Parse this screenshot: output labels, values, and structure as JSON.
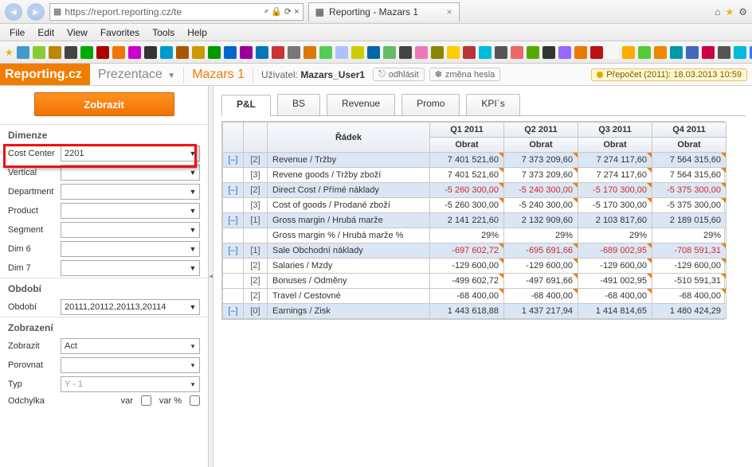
{
  "browser": {
    "url": "https://report.reporting.cz/te",
    "url_right": "𝄎 🔒 ⟳ ×",
    "search": "",
    "tab_title": "Reporting - Mazars 1",
    "menu": [
      "File",
      "Edit",
      "View",
      "Favorites",
      "Tools",
      "Help"
    ],
    "bk_colors": [
      "#49c",
      "#8c3",
      "#b80",
      "#444",
      "#0a0",
      "#a00",
      "#e70",
      "#c0c",
      "#333",
      "#09c",
      "#a50",
      "#c90",
      "#090",
      "#06c",
      "#909",
      "#07b",
      "#c33",
      "#777",
      "#d70",
      "#5c5",
      "#b0c0ff",
      "#cc0",
      "#06a",
      "#6b6",
      "#444",
      "#e7b",
      "#880",
      "#fc0",
      "#b33",
      "#0bd",
      "#555",
      "#e66",
      "#5a0",
      "#333",
      "#96f",
      "#e70",
      "#b11",
      "#f7f7f7",
      "#fa0",
      "#5c3",
      "#e80",
      "#09a",
      "#46b",
      "#c04",
      "#555",
      "#0bd",
      "#37f",
      "#0a6"
    ]
  },
  "brand": {
    "logo": "Reporting.cz",
    "prez": "Prezentace",
    "maz": "Mazars 1",
    "user_label": "Uživatel:",
    "user": "Mazars_User1",
    "logout": "odhlásit",
    "chpass": "změna hesla",
    "recalc": "Přepočet (2011): 18.03.2013 10:59"
  },
  "sidebar": {
    "show_btn": "Zobrazit",
    "grp_dim": "Dimenze",
    "dims": [
      {
        "label": "Cost Center",
        "value": "2201"
      },
      {
        "label": "Vertical",
        "value": ""
      },
      {
        "label": "Department",
        "value": ""
      },
      {
        "label": "Product",
        "value": ""
      },
      {
        "label": "Segment",
        "value": ""
      },
      {
        "label": "Dim 6",
        "value": ""
      },
      {
        "label": "Dim 7",
        "value": ""
      }
    ],
    "grp_period": "Období",
    "period_label": "Období",
    "period_value": "20111,20112,20113,20114",
    "grp_view": "Zobrazení",
    "view": [
      {
        "label": "Zobrazit",
        "value": "Act"
      },
      {
        "label": "Porovnat",
        "value": ""
      },
      {
        "label": "Typ",
        "value": "Y - 1"
      }
    ],
    "dev_label": "Odchylka",
    "dev_var": "var",
    "dev_varp": "var %"
  },
  "tabs": [
    "P&L",
    "BS",
    "Revenue",
    "Promo",
    "KPI´s"
  ],
  "grid": {
    "head1": [
      "",
      "",
      "Řádek",
      "Q1 2011",
      "Q2 2011",
      "Q3 2011",
      "Q4 2011"
    ],
    "head2": "Obrat",
    "rows": [
      {
        "exp": "[–]",
        "d": "[2]",
        "name": "Revenue / Tržby",
        "v": [
          "7 401 521,60",
          "7 373 209,60",
          "7 274 117,60",
          "7 564 315,60"
        ],
        "cls": "blue",
        "tick": true
      },
      {
        "exp": "",
        "d": "[3]",
        "name": "Revene goods / Tržby zboží",
        "v": [
          "7 401 521,60",
          "7 373 209,60",
          "7 274 117,60",
          "7 564 315,60"
        ],
        "tick": true
      },
      {
        "exp": "[–]",
        "d": "[2]",
        "name": "Direct Cost / Přímé náklady",
        "v": [
          "-5 260 300,00",
          "-5 240 300,00",
          "-5 170 300,00",
          "-5 375 300,00"
        ],
        "cls": "blue",
        "neg": true,
        "tick": true
      },
      {
        "exp": "",
        "d": "[3]",
        "name": "Cost of goods / Prodané zboží",
        "v": [
          "-5 260 300,00",
          "-5 240 300,00",
          "-5 170 300,00",
          "-5 375 300,00"
        ],
        "tick": true
      },
      {
        "exp": "[–]",
        "d": "[1]",
        "name": "Gross margin / Hrubá marže",
        "v": [
          "2 141 221,60",
          "2 132 909,60",
          "2 103 817,60",
          "2 189 015,60"
        ],
        "cls": "blue"
      },
      {
        "exp": "",
        "d": "",
        "name": "Gross margin % / Hrubá marže %",
        "v": [
          "29%",
          "29%",
          "29%",
          "29%"
        ]
      },
      {
        "exp": "[–]",
        "d": "[1]",
        "name": "Sale Obchodní náklady",
        "v": [
          "-697 602,72",
          "-695 691,66",
          "-689 002,95",
          "-708 591,31"
        ],
        "cls": "blue",
        "neg": true,
        "tick": true
      },
      {
        "exp": "",
        "d": "[2]",
        "name": "Salaries / Mzdy",
        "v": [
          "-129 600,00",
          "-129 600,00",
          "-129 600,00",
          "-129 600,00"
        ],
        "tick": true
      },
      {
        "exp": "",
        "d": "[2]",
        "name": "Bonuses / Odměny",
        "v": [
          "-499 602,72",
          "-497 691,66",
          "-491 002,95",
          "-510 591,31"
        ],
        "tick": true
      },
      {
        "exp": "",
        "d": "[2]",
        "name": "Travel / Cestovné",
        "v": [
          "-68 400,00",
          "-68 400,00",
          "-68 400,00",
          "-68 400,00"
        ],
        "tick": true
      },
      {
        "exp": "[–]",
        "d": "[0]",
        "name": "Earnings / Zisk",
        "v": [
          "1 443 618,88",
          "1 437 217,94",
          "1 414 814,65",
          "1 480 424,29"
        ],
        "cls": "blue"
      }
    ]
  }
}
